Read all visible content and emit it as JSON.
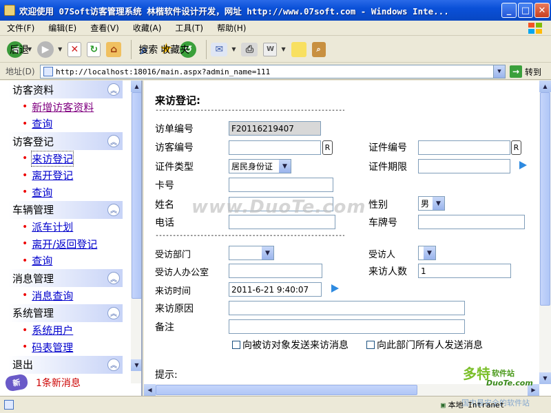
{
  "window": {
    "title": "欢迎使用 07Soft访客管理系统   林楷软件设计开发，网址 http://www.07soft.com - Windows Inte...",
    "minimize": "_",
    "maximize": "□",
    "close": "✕"
  },
  "menu": [
    "文件(F)",
    "编辑(E)",
    "查看(V)",
    "收藏(A)",
    "工具(T)",
    "帮助(H)"
  ],
  "toolbar": {
    "back": "后退",
    "search": "搜索",
    "favorites": "收藏夹"
  },
  "address": {
    "label": "地址(D)",
    "url": "http://localhost:18016/main.aspx?admin_name=111",
    "go": "转到"
  },
  "sidebar": {
    "groups": [
      {
        "title": "访客资料",
        "items": [
          "新增访客资料",
          "查询"
        ]
      },
      {
        "title": "访客登记",
        "items": [
          "来访登记",
          "离开登记",
          "查询"
        ]
      },
      {
        "title": "车辆管理",
        "items": [
          "派车计划",
          "离开/返回登记",
          "查询"
        ]
      },
      {
        "title": "消息管理",
        "items": [
          "消息查询"
        ]
      },
      {
        "title": "系统管理",
        "items": [
          "系统用户",
          "码表管理"
        ]
      },
      {
        "title": "退出",
        "items": []
      }
    ],
    "new_badge": "新",
    "new_message": "1条新消息"
  },
  "form": {
    "title": "来访登记:",
    "divider": "------------------------------------------------------------",
    "visit_no_label": "访单编号",
    "visit_no_value": "F20116219407",
    "visitor_no_label": "访客编号",
    "visitor_no_value": "",
    "r_button": "R",
    "id_no_label": "证件编号",
    "id_no_value": "",
    "id_type_label": "证件类型",
    "id_type_value": "居民身份证",
    "id_expiry_label": "证件期限",
    "card_label": "卡号",
    "name_label": "姓名",
    "gender_label": "性别",
    "gender_value": "男",
    "phone_label": "电话",
    "plate_label": "车牌号",
    "dept_label": "受访部门",
    "host_label": "受访人",
    "host_office_label": "受访人办公室",
    "visitor_count_label": "来访人数",
    "visitor_count_value": "1",
    "visit_time_label": "来访时间",
    "visit_time_value": "2011-6-21 9:40:07",
    "reason_label": "来访原因",
    "remark_label": "备注",
    "notify_host": "向被访对象发送来访消息",
    "notify_dept": "向此部门所有人发送消息",
    "tips_label": "提示:"
  },
  "watermark": "www.DuoTe.com",
  "corner_logo": {
    "big": "多特",
    "small": "软件站",
    "url": "DuoTe.com"
  },
  "status": {
    "zone": "本地 Intranet",
    "watermark_note": "国内最安全的软件站"
  },
  "colors": {
    "titlebar": "#0a50d8",
    "sidebar_group": "#c7d3f7",
    "link": "#0000cc",
    "bullet": "#ee0000",
    "new_message": "#cc0000"
  }
}
